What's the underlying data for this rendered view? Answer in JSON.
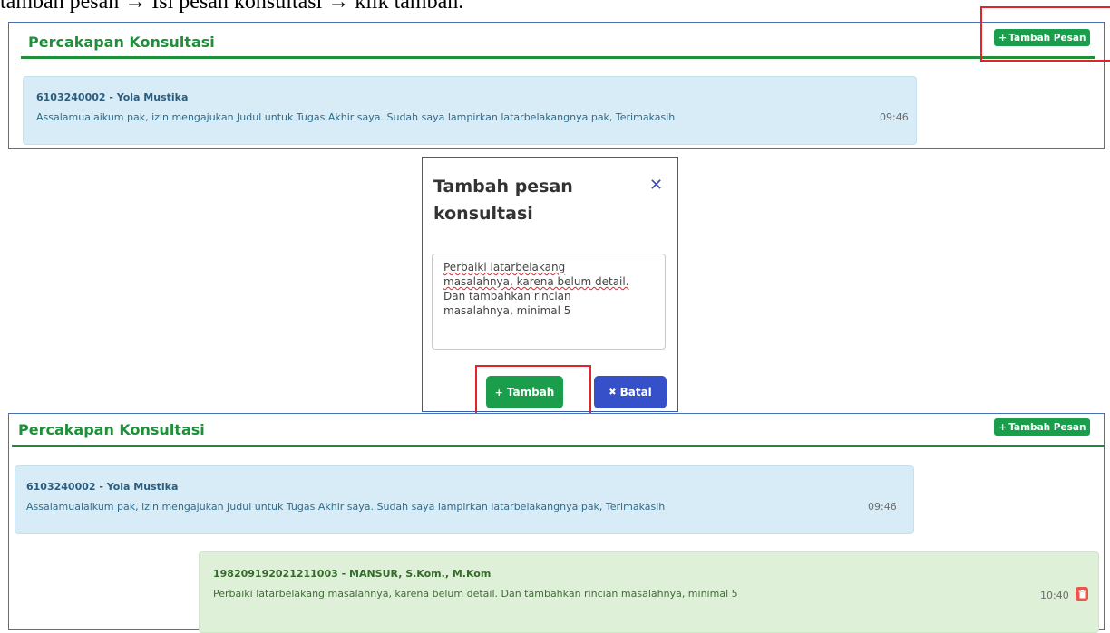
{
  "caption": "tambah pesan → Isi pesan konsultasi → klik tambah.",
  "panel_top": {
    "title": "Percakapan Konsultasi",
    "add_button": "Tambah Pesan",
    "message": {
      "sender": "6103240002 - Yola Mustika",
      "text": "Assalamualaikum pak, izin mengajukan Judul untuk Tugas Akhir saya. Sudah saya lampirkan latarbelakangnya pak, Terimakasih",
      "time": "09:46"
    }
  },
  "modal": {
    "title": "Tambah pesan konsultasi",
    "textarea_lines": [
      "Perbaiki latarbelakang",
      "masalahnya, karena belum detail.",
      "Dan tambahkan rincian",
      "masalahnya, minimal 5"
    ],
    "tambah_label": "Tambah",
    "batal_label": "Batal"
  },
  "panel_bottom": {
    "title": "Percakapan Konsultasi",
    "add_button": "Tambah Pesan",
    "messages": [
      {
        "sender": "6103240002 - Yola Mustika",
        "text": "Assalamualaikum pak, izin mengajukan Judul untuk Tugas Akhir saya. Sudah saya lampirkan latarbelakangnya pak, Terimakasih",
        "time": "09:46"
      },
      {
        "sender": "198209192021211003 - MANSUR, S.Kom., M.Kom",
        "text": "Perbaiki latarbelakang masalahnya, karena belum detail. Dan tambahkan rincian masalahnya, minimal 5",
        "time": "10:40"
      }
    ]
  },
  "colors": {
    "green": "#1b9e4b",
    "title_green": "#1f8f3a",
    "blue_bubble": "#d7ecf6",
    "green_bubble": "#dff0d8",
    "red_highlight": "#e0242b",
    "batal_blue": "#3550c8",
    "trash_red": "#e8574d"
  }
}
